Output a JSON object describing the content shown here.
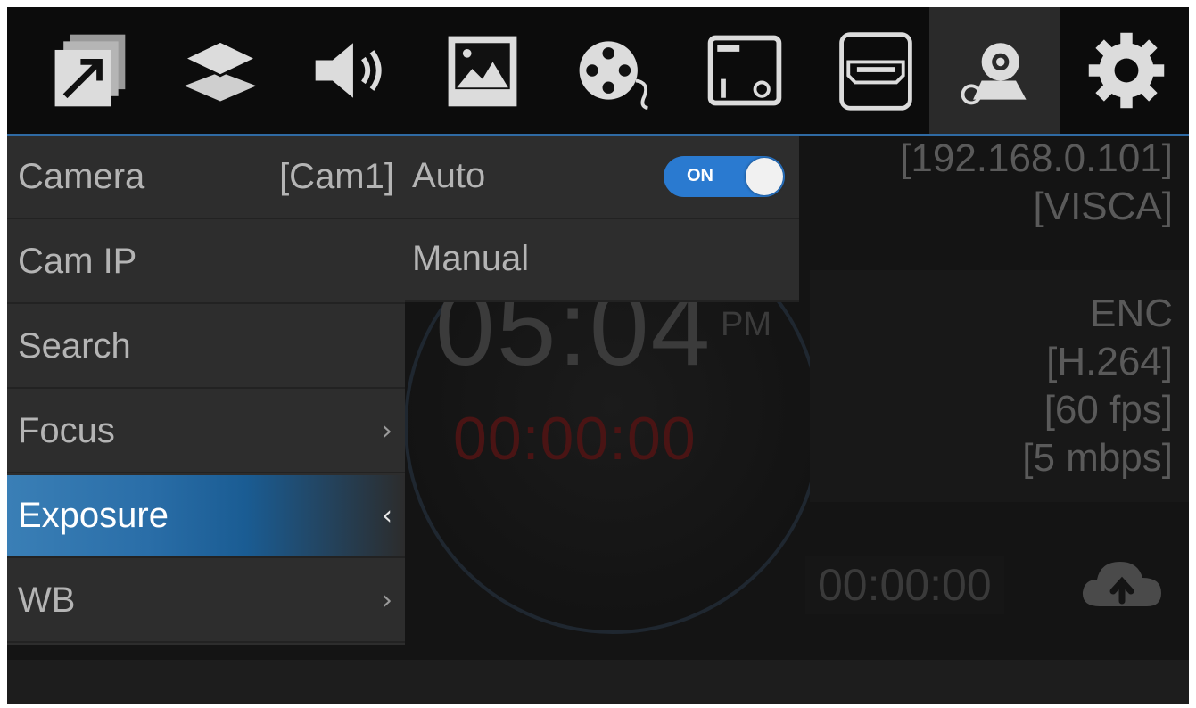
{
  "toolbar": {
    "icons": [
      "output-icon",
      "layers-icon",
      "audio-icon",
      "image-icon",
      "video-reel-icon",
      "window-settings-icon",
      "hdmi-icon",
      "camera-settings-icon",
      "gear-icon"
    ],
    "active_index": 7
  },
  "status": {
    "cam_ip": "[192.168.0.101]",
    "protocol": "[VISCA]",
    "clock": "05:04",
    "ampm": "PM",
    "rec_timer": "00:00:00",
    "enc_label": "ENC",
    "codec": "[H.264]",
    "fps": "[60 fps]",
    "bitrate": "[5 mbps]",
    "stream_timer": "00:00:00"
  },
  "menu": {
    "items": [
      {
        "label": "Camera",
        "value": "[Cam1]",
        "chev": ""
      },
      {
        "label": "Cam IP",
        "value": "",
        "chev": ""
      },
      {
        "label": "Search",
        "value": "",
        "chev": ""
      },
      {
        "label": "Focus",
        "value": "",
        "chev": "›"
      },
      {
        "label": "Exposure",
        "value": "",
        "chev": "‹"
      },
      {
        "label": "WB",
        "value": "",
        "chev": "›"
      }
    ],
    "selected_index": 4
  },
  "submenu": {
    "items": [
      {
        "label": "Auto"
      },
      {
        "label": "Manual"
      }
    ],
    "toggle_text": "ON",
    "toggle_on": true
  },
  "colors": {
    "accent": "#2f6aa3",
    "toggle": "#2a7ad0",
    "rec_red": "#4a1414"
  }
}
